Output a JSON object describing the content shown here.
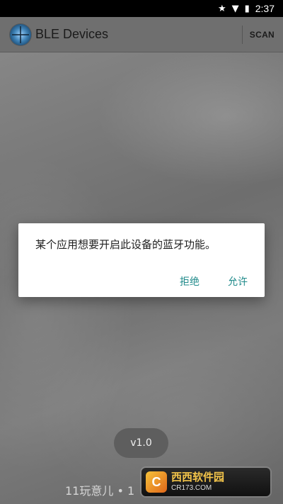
{
  "status_bar": {
    "time": "2:37",
    "icons": [
      "star-icon",
      "wifi-icon",
      "battery-icon"
    ]
  },
  "app_bar": {
    "title": "BLE Devices",
    "scan_label": "SCAN"
  },
  "dialog": {
    "message": "某个应用想要开启此设备的蓝牙功能。",
    "deny_label": "拒绝",
    "allow_label": "允许",
    "button_color": "#1f8a8a"
  },
  "version": {
    "label": "v1.0"
  },
  "watermark": {
    "text": "11玩意儿 • 1",
    "logo_glyph": "C",
    "brand": "西西软件园",
    "url": "CR173.COM"
  },
  "colors": {
    "status_bar_bg": "#000000",
    "app_bar_bg": "#6f6f6f",
    "dialog_bg": "#ffffff"
  }
}
